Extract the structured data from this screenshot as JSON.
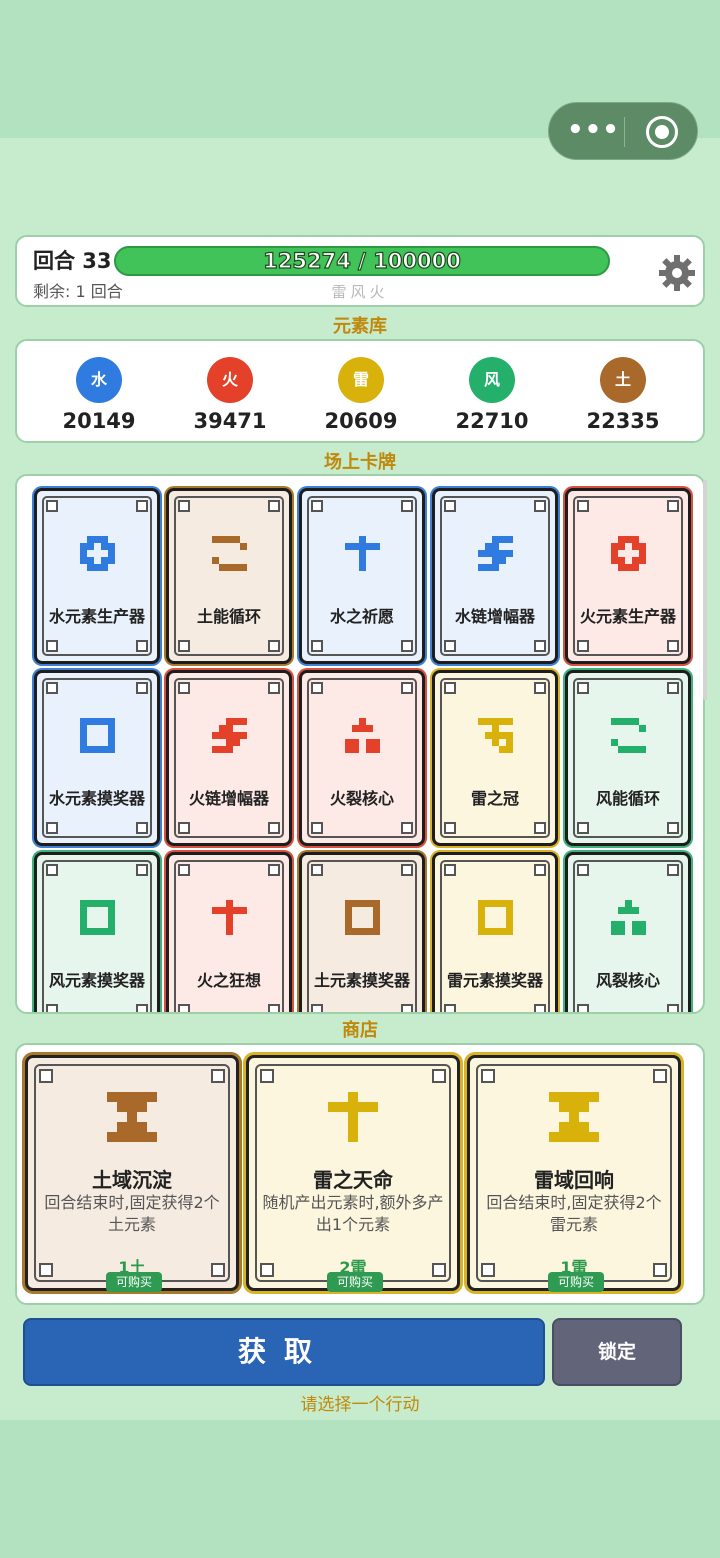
{
  "header": {
    "round_label": "回合 33",
    "remaining": "剩余: 1 回合",
    "progress_text": "125274 / 100000",
    "progress_fraction": 1.0,
    "sub_elements": "雷风火"
  },
  "element_title": "元素库",
  "elements": [
    {
      "label": "水",
      "value": "20149",
      "color": "#2f7be0"
    },
    {
      "label": "火",
      "value": "39471",
      "color": "#e3412a"
    },
    {
      "label": "雷",
      "value": "20609",
      "color": "#d8b10a"
    },
    {
      "label": "风",
      "value": "22710",
      "color": "#24b06a"
    },
    {
      "label": "土",
      "value": "22335",
      "color": "#a8692a"
    }
  ],
  "field_title": "场上卡牌",
  "cards": [
    {
      "name": "水元素生产器",
      "element": "water",
      "icon": "grid-icon"
    },
    {
      "name": "土能循环",
      "element": "earth",
      "icon": "cycle-icon"
    },
    {
      "name": "水之祈愿",
      "element": "water",
      "icon": "cross-icon"
    },
    {
      "name": "水链增幅器",
      "element": "water",
      "icon": "chain-icon"
    },
    {
      "name": "火元素生产器",
      "element": "fire",
      "icon": "grid-icon"
    },
    {
      "name": "水元素摸奖器",
      "element": "water",
      "icon": "square-icon"
    },
    {
      "name": "火链增幅器",
      "element": "fire",
      "icon": "chain-icon"
    },
    {
      "name": "火裂核心",
      "element": "fire",
      "icon": "split-icon"
    },
    {
      "name": "雷之冠",
      "element": "thunder",
      "icon": "crown-icon"
    },
    {
      "name": "风能循环",
      "element": "wind",
      "icon": "cycle-icon"
    },
    {
      "name": "风元素摸奖器",
      "element": "wind",
      "icon": "square-icon"
    },
    {
      "name": "火之狂想",
      "element": "fire",
      "icon": "cross-icon"
    },
    {
      "name": "土元素摸奖器",
      "element": "earth",
      "icon": "square-icon"
    },
    {
      "name": "雷元素摸奖器",
      "element": "thunder",
      "icon": "square-icon"
    },
    {
      "name": "风裂核心",
      "element": "wind",
      "icon": "split-icon"
    }
  ],
  "shop_title": "商店",
  "shop": [
    {
      "title": "土域沉淀",
      "desc": "回合结束时,固定获得2个土元素",
      "price": "1土",
      "buy": "可购买",
      "element": "earth",
      "icon": "hourglass-icon"
    },
    {
      "title": "雷之天命",
      "desc": "随机产出元素时,额外多产出1个元素",
      "price": "2雷",
      "buy": "可购买",
      "element": "thunder",
      "icon": "cross-icon"
    },
    {
      "title": "雷域回响",
      "desc": "回合结束时,固定获得2个雷元素",
      "price": "1雷",
      "buy": "可购买",
      "element": "thunder",
      "icon": "hourglass-icon"
    }
  ],
  "actions": {
    "get": "获取",
    "lock": "锁定",
    "hint": "请选择一个行动"
  },
  "palette": {
    "water": {
      "bg": "#e9f1fd",
      "border": "#3d80d8",
      "icon": "#2f7be0"
    },
    "fire": {
      "bg": "#fde9e6",
      "border": "#d8503e",
      "icon": "#e3412a"
    },
    "earth": {
      "bg": "#f5ebe1",
      "border": "#a8792a",
      "icon": "#a8692a"
    },
    "thunder": {
      "bg": "#fdf6df",
      "border": "#d9b325",
      "icon": "#d8b10a"
    },
    "wind": {
      "bg": "#e6f6ec",
      "border": "#3cb37a",
      "icon": "#24b06a"
    }
  }
}
